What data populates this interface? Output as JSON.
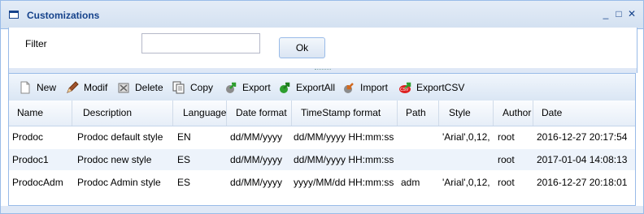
{
  "window": {
    "title": "Customizations",
    "controls": [
      "_",
      "□",
      "✕"
    ]
  },
  "filter": {
    "label": "Filter",
    "value": "",
    "ok_label": "Ok"
  },
  "toolbar": {
    "items": [
      {
        "label": "New",
        "icon": "new-document-icon"
      },
      {
        "label": "Modif",
        "icon": "pencil-icon"
      },
      {
        "label": "Delete",
        "icon": "delete-icon"
      },
      {
        "label": "Copy",
        "icon": "copy-icon"
      },
      {
        "label": "Export",
        "icon": "export-icon"
      },
      {
        "label": "ExportAll",
        "icon": "export-all-icon"
      },
      {
        "label": "Import",
        "icon": "import-icon"
      },
      {
        "label": "ExportCSV",
        "icon": "csv-icon"
      }
    ]
  },
  "grid": {
    "columns": [
      "Name",
      "Description",
      "Language",
      "Date format",
      "TimeStamp format",
      "Path",
      "Style",
      "Author",
      "Date"
    ],
    "rows": [
      [
        "Prodoc",
        "Prodoc default style",
        "EN",
        "dd/MM/yyyy",
        "dd/MM/yyyy HH:mm:ss",
        "",
        "'Arial',0,12,",
        "root",
        "2016-12-27 20:17:54"
      ],
      [
        "Prodoc1",
        "Prodoc new style",
        "ES",
        "dd/MM/yyyy",
        "dd/MM/yyyy HH:mm:ss",
        "",
        "",
        "root",
        "2017-01-04 14:08:13"
      ],
      [
        "ProdocAdm",
        "Prodoc Admin style",
        "ES",
        "dd/MM/yyyy",
        "yyyy/MM/dd HH:mm:ss",
        "adm",
        "'Arial',0,12,",
        "root",
        "2016-12-27 20:18:01"
      ]
    ]
  },
  "colors": {
    "header_text": "#15428b",
    "border": "#99bbe8",
    "alt_row": "#edf3fb"
  }
}
